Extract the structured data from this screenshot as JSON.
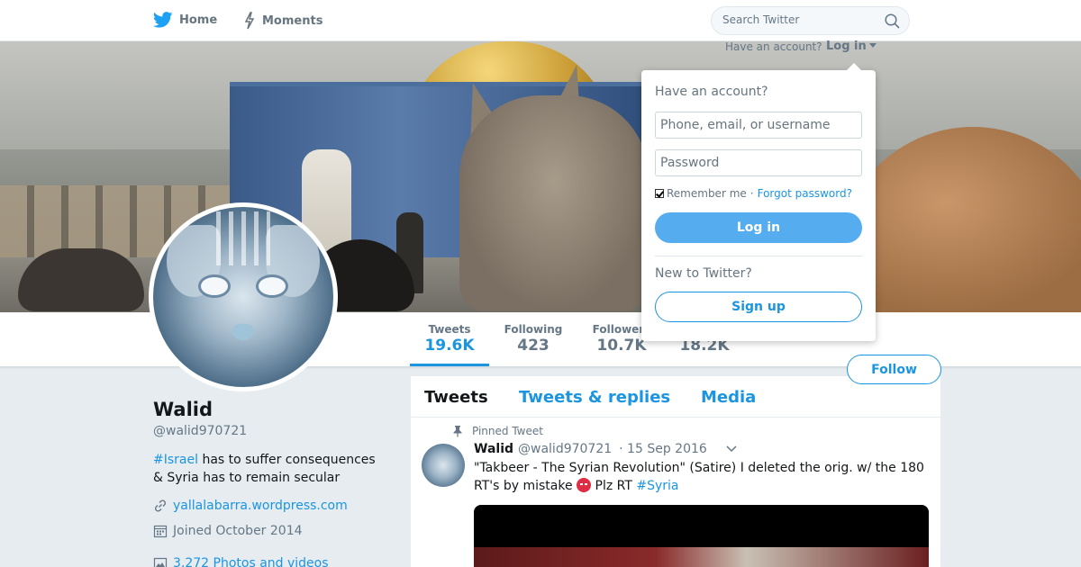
{
  "nav": {
    "home_label": "Home",
    "moments_label": "Moments",
    "search_placeholder": "Search Twitter"
  },
  "login_menu": {
    "caption": "Have an account?",
    "toggle_label": "Log in",
    "title": "Have an account?",
    "username_placeholder": "Phone, email, or username",
    "password_placeholder": "Password",
    "remember_label": "Remember me",
    "separator": "·",
    "forgot_label": "Forgot password?",
    "login_button": "Log in",
    "new_prompt": "New to Twitter?",
    "signup_button": "Sign up"
  },
  "stats": {
    "tweets": {
      "label": "Tweets",
      "value": "19.6K"
    },
    "following": {
      "label": "Following",
      "value": "423"
    },
    "followers": {
      "label": "Followers",
      "value": "10.7K"
    },
    "likes": {
      "value": "18.2K"
    }
  },
  "follow_button": "Follow",
  "profile": {
    "name": "Walid",
    "handle": "@walid970721",
    "bio_hashtag": "#Israel",
    "bio_text": " has to suffer consequences & Syria has to remain secular",
    "url": "yallalabarra.wordpress.com",
    "joined": "Joined October 2014",
    "photos": "3,272 Photos and videos"
  },
  "timeline": {
    "tabs": [
      {
        "label": "Tweets"
      },
      {
        "label": "Tweets & replies"
      },
      {
        "label": "Media"
      }
    ],
    "pinned_label": "Pinned Tweet",
    "tweet": {
      "name": "Walid",
      "handle": "@walid970721",
      "date": "· 15 Sep 2016",
      "text": "\"Takbeer - The Syrian Revolution\" (Satire) I deleted the orig. w/ the 180 RT's by mistake ",
      "text_after_emoji": " Plz RT ",
      "hashtag": "#Syria"
    }
  },
  "colors": {
    "accent": "#1b95e0",
    "login_button": "#55acee",
    "text_secondary": "#657786",
    "background": "#e6ecf0"
  },
  "icons": {
    "home": "bird-icon",
    "moments": "lightning-icon",
    "search": "search-icon",
    "pin": "pin-icon",
    "link": "link-icon",
    "calendar": "calendar-icon",
    "photos": "photo-icon",
    "caret": "chevron-down-icon",
    "emoji": "angry-face-emoji"
  }
}
